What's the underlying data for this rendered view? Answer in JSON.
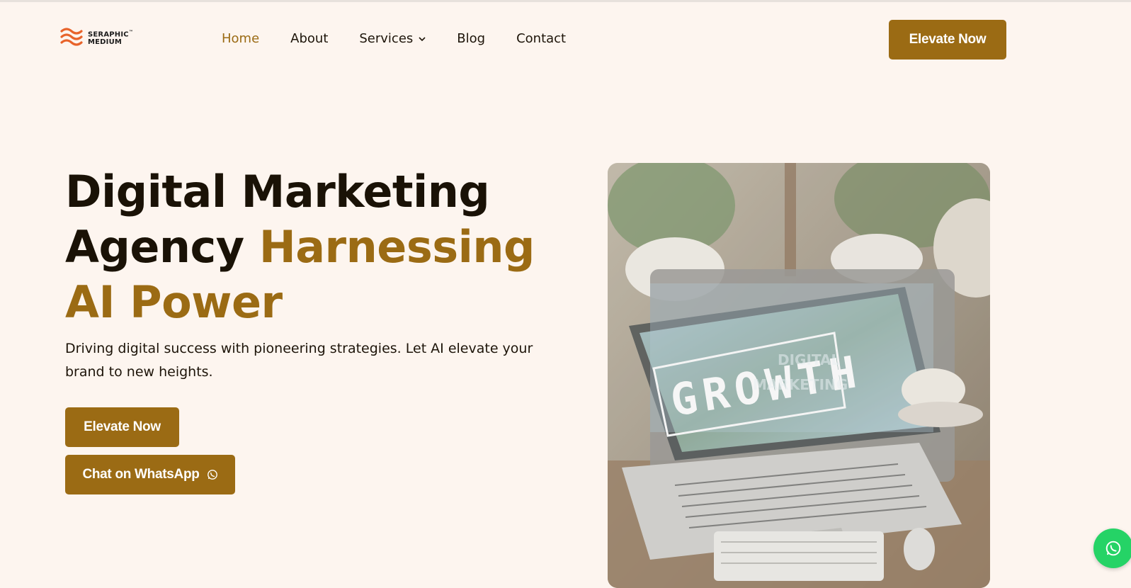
{
  "brand": {
    "line1": "SERAPHIC",
    "line2": "MEDIUM",
    "tm": "™"
  },
  "nav": {
    "home": "Home",
    "about": "About",
    "services": "Services",
    "blog": "Blog",
    "contact": "Contact"
  },
  "header": {
    "cta_label": "Elevate Now"
  },
  "hero": {
    "title_line1": "Digital Marketing",
    "title_line2_plain": "Agency",
    "title_line2_accent": "Harnessing",
    "title_line3_accent": "AI Power",
    "subtitle": "Driving digital success with pioneering strategies. Let AI elevate your brand to new heights.",
    "cta_primary": "Elevate Now",
    "cta_whatsapp": "Chat on WhatsApp",
    "image_text_main": "GROWTH",
    "image_text_overlay_1": "DIGITAL",
    "image_text_overlay_2": "MARKETING"
  },
  "colors": {
    "background": "#fdf5ef",
    "accent": "#9b6b14",
    "text": "#1d1409",
    "whatsapp": "#25d366"
  },
  "icons": {
    "logo": "wave-logo-icon",
    "services_dropdown": "chevron-down-icon",
    "whatsapp": "whatsapp-icon"
  }
}
